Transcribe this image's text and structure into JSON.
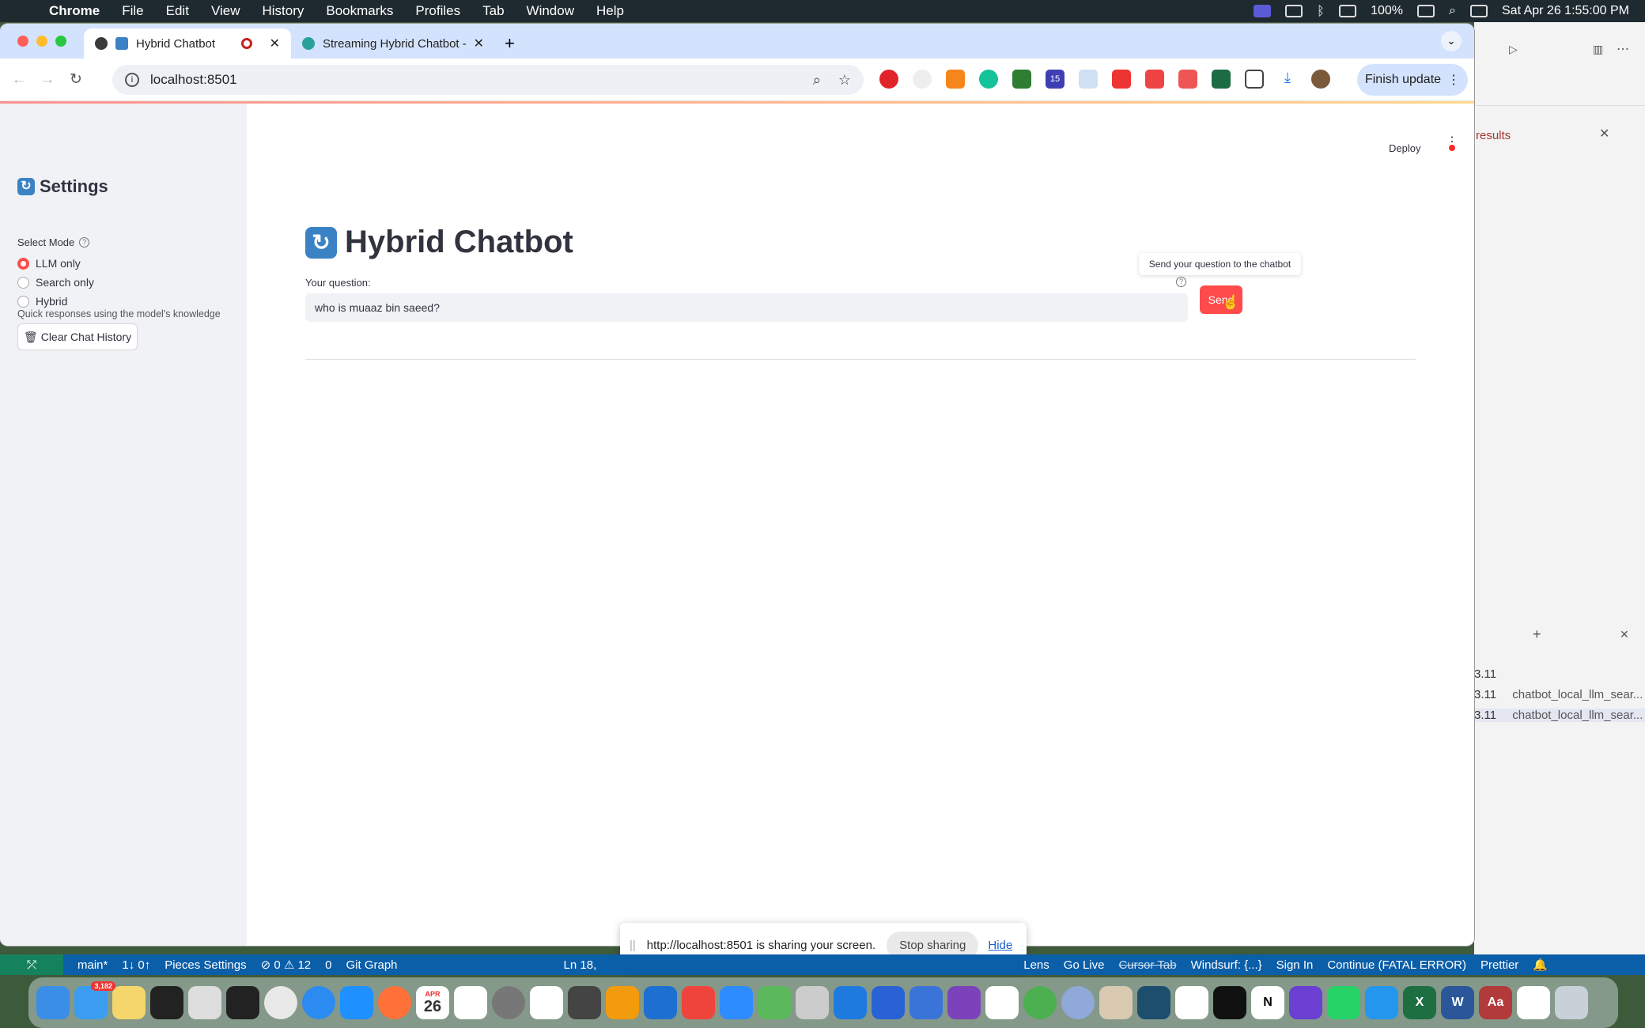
{
  "menubar": {
    "app": "Chrome",
    "items": [
      "File",
      "Edit",
      "View",
      "History",
      "Bookmarks",
      "Profiles",
      "Tab",
      "Window",
      "Help"
    ],
    "battery": "100%",
    "datetime": "Sat Apr 26  1:55:00 PM"
  },
  "browser": {
    "tabs": [
      {
        "label": "Hybrid Chatbot"
      },
      {
        "label": "Streaming Hybrid Chatbot - S"
      }
    ],
    "url": "localhost:8501",
    "finish_update": "Finish update",
    "ext_badge": "15"
  },
  "app": {
    "deploy": "Deploy",
    "sidebar": {
      "title": "Settings",
      "mode_label": "Select Mode",
      "modes": [
        "LLM only",
        "Search only",
        "Hybrid"
      ],
      "selected_mode": "LLM only",
      "caption": "Quick responses using the model's knowledge",
      "clear_button": "Clear Chat History"
    },
    "main": {
      "title": "Hybrid Chatbot",
      "question_label": "Your question:",
      "question_value": "who is muaaz bin saeed?",
      "send_button": "Send",
      "send_tooltip": "Send your question to the chatbot"
    }
  },
  "share_bar": {
    "message": "http://localhost:8501 is sharing your screen.",
    "stop": "Stop sharing",
    "hide": "Hide"
  },
  "ide": {
    "find_label": "results",
    "terminal_rows": [
      {
        "version": "3.11",
        "name": ""
      },
      {
        "version": "3.11",
        "name": "chatbot_local_llm_sear..."
      },
      {
        "version": "3.11",
        "name": "chatbot_local_llm_sear..."
      }
    ]
  },
  "statusbar": {
    "branch": "main*",
    "sync": "1↓ 0↑",
    "pieces": "Pieces Settings",
    "problems": "⊘ 0 ⚠ 12",
    "ports": "0",
    "git_graph": "Git Graph",
    "position": "Ln 18,",
    "lens": "Lens",
    "go_live": "Go Live",
    "cursor_tab": "Cursor Tab",
    "windsurf": "Windsurf: {...}",
    "sign_in": "Sign In",
    "continue": "Continue (FATAL ERROR)",
    "prettier": "Prettier"
  },
  "dock": {
    "mail_badge": "3,182",
    "calendar_month": "APR",
    "calendar_day": "26"
  },
  "colors": {
    "accent": "#ff4b4b",
    "sidebar_bg": "#f0f2f6",
    "tabstrip_bg": "#d3e3fd",
    "statusbar_bg": "#0b5ea8"
  }
}
